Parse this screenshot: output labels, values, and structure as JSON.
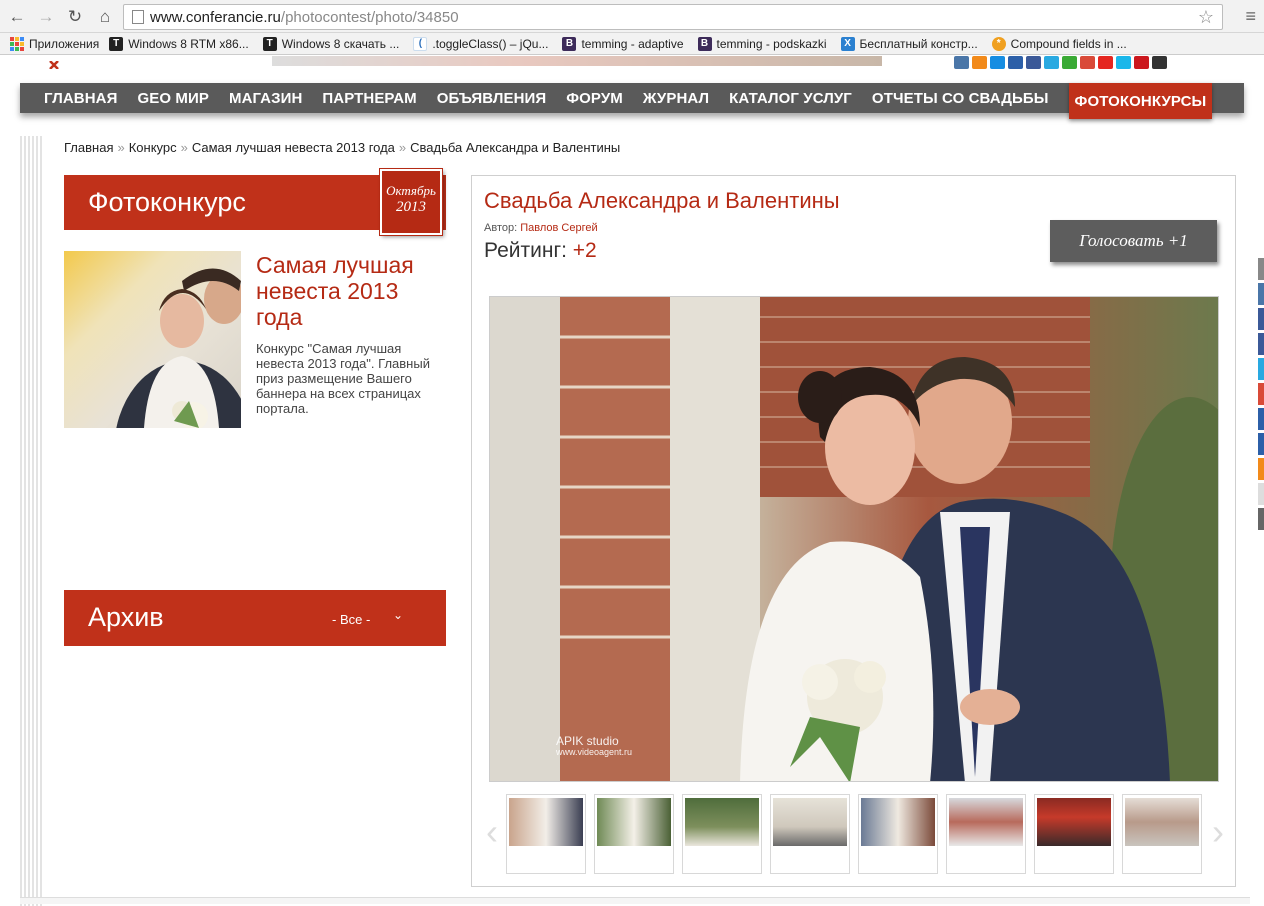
{
  "browser": {
    "url_domain": "www.conferancie.ru",
    "url_path": "/photocontest/photo/34850",
    "bookmarks": [
      {
        "label": "Приложения",
        "icon": "apps-grid-icon"
      },
      {
        "label": "Windows 8 RTM x86...",
        "icon": "t-icon"
      },
      {
        "label": "Windows 8 скачать ...",
        "icon": "t-icon"
      },
      {
        "label": ".toggleClass() – jQu...",
        "icon": "jquery-icon"
      },
      {
        "label": "temming - adaptive",
        "icon": "b-icon"
      },
      {
        "label": "temming - podskazki",
        "icon": "b-icon"
      },
      {
        "label": "Бесплатный констр...",
        "icon": "x-icon"
      },
      {
        "label": "Compound fields in ...",
        "icon": "sun-icon"
      }
    ]
  },
  "nav": {
    "items": [
      {
        "label": "ГЛАВНАЯ"
      },
      {
        "label": "GEO МИР"
      },
      {
        "label": "МАГАЗИН"
      },
      {
        "label": "ПАРТНЕРАМ"
      },
      {
        "label": "ОБЪЯВЛЕНИЯ"
      },
      {
        "label": "ФОРУМ"
      },
      {
        "label": "ЖУРНАЛ"
      },
      {
        "label": "КАТАЛОГ УСЛУГ"
      },
      {
        "label": "ОТЧЕТЫ СО СВАДЬБЫ"
      },
      {
        "label": "ФОТОКОНКУРСЫ"
      }
    ],
    "active": "ФОТОКОНКУРСЫ"
  },
  "breadcrumb": {
    "items": [
      "Главная",
      "Конкурс",
      "Самая лучшая невеста 2013 года",
      "Свадьба Александра и Валентины"
    ],
    "separator": "»"
  },
  "sidebar": {
    "contest_heading": "Фотоконкурс",
    "badge_month": "Октябрь",
    "badge_year": "2013",
    "contest_title": "Самая лучшая невеста 2013 года",
    "contest_desc": "Конкурс \"Самая лучшая невеста 2013 года\". Главный приз размещение Вашего баннера на всех страницах портала.",
    "archive_heading": "Архив",
    "archive_select": "- Все -"
  },
  "photo": {
    "title": "Свадьба Александра и Валентины",
    "author_label": "Автор:",
    "author_name": "Павлов Сергей",
    "rating_label": "Рейтинг:",
    "rating_value": "+2",
    "vote_button": "Голосовать +1",
    "watermark_line1": "APIK studio",
    "watermark_line2": "www.videoagent.ru"
  },
  "thumbnails": [
    {
      "name": "thumb-1",
      "color": "#b9a08a"
    },
    {
      "name": "thumb-2",
      "color": "#6f8a55"
    },
    {
      "name": "thumb-3",
      "color": "#4f6d3c"
    },
    {
      "name": "thumb-4",
      "color": "#d9d4c8"
    },
    {
      "name": "thumb-5",
      "color": "#7a7e8a"
    },
    {
      "name": "thumb-6",
      "color": "#b86a5c"
    },
    {
      "name": "thumb-7",
      "color": "#8a2a22"
    },
    {
      "name": "thumb-8",
      "color": "#b89a8a"
    }
  ],
  "colors": {
    "accent": "#c0311a",
    "nav_bg": "#5a5a5a"
  }
}
